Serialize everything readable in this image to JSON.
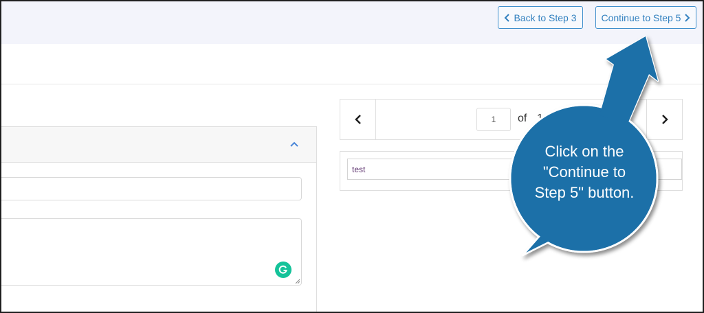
{
  "toolbar": {
    "back_label": "Back to Step 3",
    "continue_label": "Continue to Step 5"
  },
  "pager": {
    "current_page": "1",
    "of_label": "of",
    "total_pages": "1"
  },
  "results": {
    "value": "test"
  },
  "callout": {
    "line1": "Click on the",
    "line2": "\"Continue to",
    "line3": "Step 5\" button."
  },
  "colors": {
    "accent": "#3180bf",
    "callout": "#1b6fa8",
    "grammarly": "#15c39a"
  },
  "icons": {
    "back": "chevron-left-icon",
    "continue": "chevron-right-icon",
    "collapse": "chevron-up-icon",
    "grammarly": "grammarly-icon"
  }
}
